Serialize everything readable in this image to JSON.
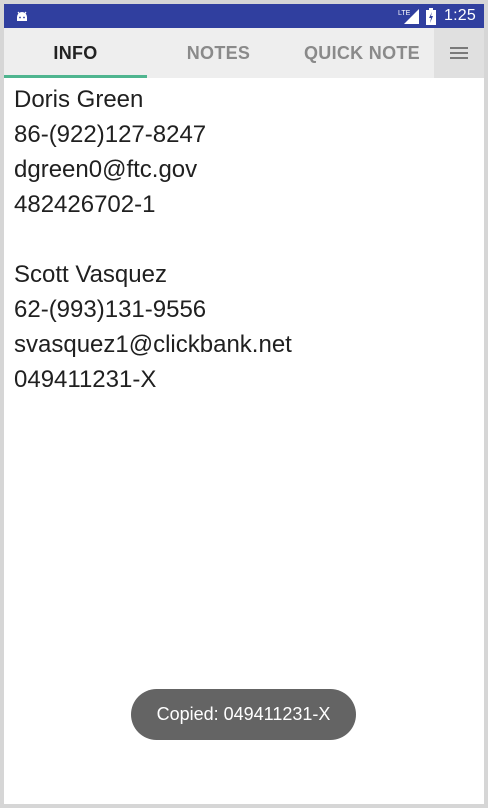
{
  "status_bar": {
    "time": "1:25",
    "network_label": "LTE",
    "icons": [
      "android-icon",
      "lte-signal-icon",
      "battery-charging-icon"
    ],
    "background": "#303f9f"
  },
  "tabs": [
    {
      "label": "INFO",
      "selected": true
    },
    {
      "label": "NOTES",
      "selected": false
    },
    {
      "label": "QUICK NOTE",
      "selected": false
    }
  ],
  "tab_indicator_color": "#4fb58f",
  "menu_icon": "menu-icon",
  "contacts": [
    {
      "name": "Doris Green",
      "phone": "86-(922)127-8247",
      "email": "dgreen0@ftc.gov",
      "id": "482426702-1"
    },
    {
      "name": "Scott Vasquez",
      "phone": "62-(993)131-9556",
      "email": "svasquez1@clickbank.net",
      "id": "049411231-X"
    }
  ],
  "toast": {
    "text": "Copied: 049411231-X"
  }
}
